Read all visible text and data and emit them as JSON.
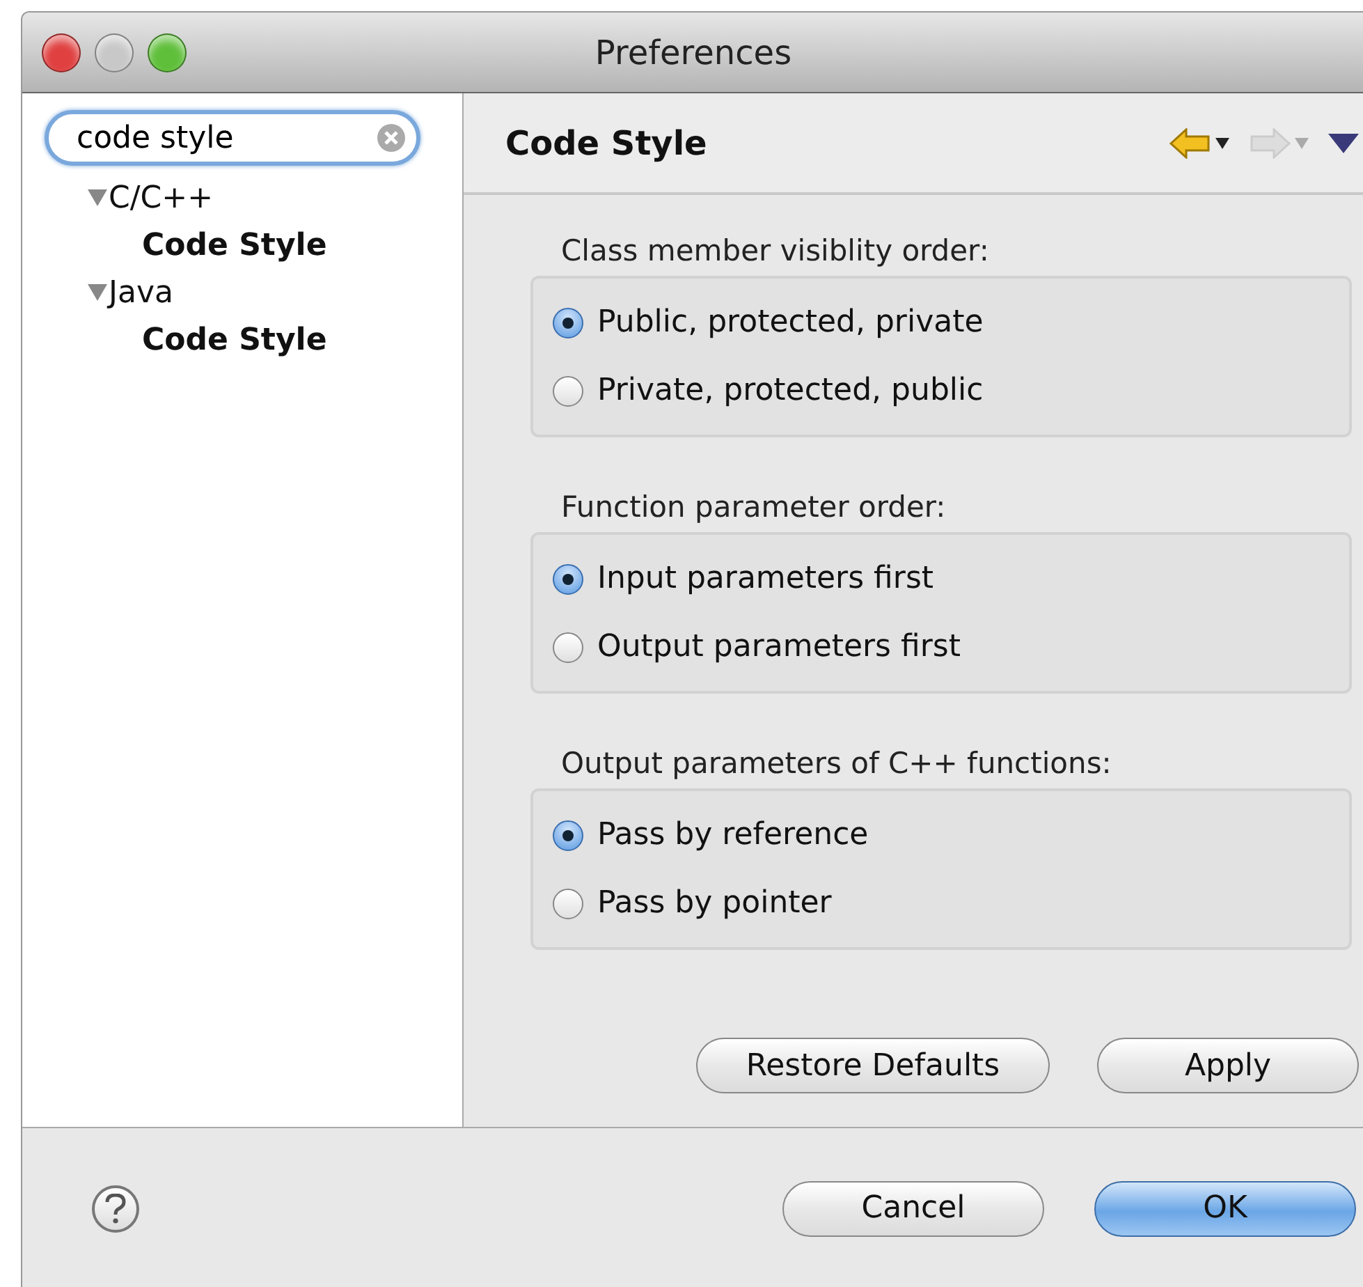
{
  "window": {
    "title": "Preferences"
  },
  "search": {
    "value": "code style"
  },
  "tree": [
    {
      "label": "C/C++",
      "expanded": true,
      "children": [
        {
          "label": "Code Style"
        }
      ]
    },
    {
      "label": "Java",
      "expanded": true,
      "children": [
        {
          "label": "Code Style"
        }
      ]
    }
  ],
  "page": {
    "title": "Code Style"
  },
  "toolbar": [
    {
      "kind": "back",
      "disabled": false
    },
    {
      "kind": "forward",
      "disabled": true
    },
    {
      "kind": "menu"
    }
  ],
  "groups": [
    {
      "label": "Class member visiblity order:",
      "options": [
        {
          "label": "Public, protected, private",
          "selected": true
        },
        {
          "label": "Private, protected, public",
          "selected": false
        }
      ]
    },
    {
      "label": "Function parameter order:",
      "options": [
        {
          "label": "Input parameters first",
          "selected": true
        },
        {
          "label": "Output parameters first",
          "selected": false
        }
      ]
    },
    {
      "label": "Output parameters of C++ functions:",
      "options": [
        {
          "label": "Pass by reference",
          "selected": true
        },
        {
          "label": "Pass by pointer",
          "selected": false
        }
      ]
    }
  ],
  "page_buttons": [
    "Restore Defaults",
    "Apply"
  ],
  "dialog_buttons": [
    {
      "label": "Cancel",
      "default": false
    },
    {
      "label": "OK",
      "default": true
    }
  ]
}
